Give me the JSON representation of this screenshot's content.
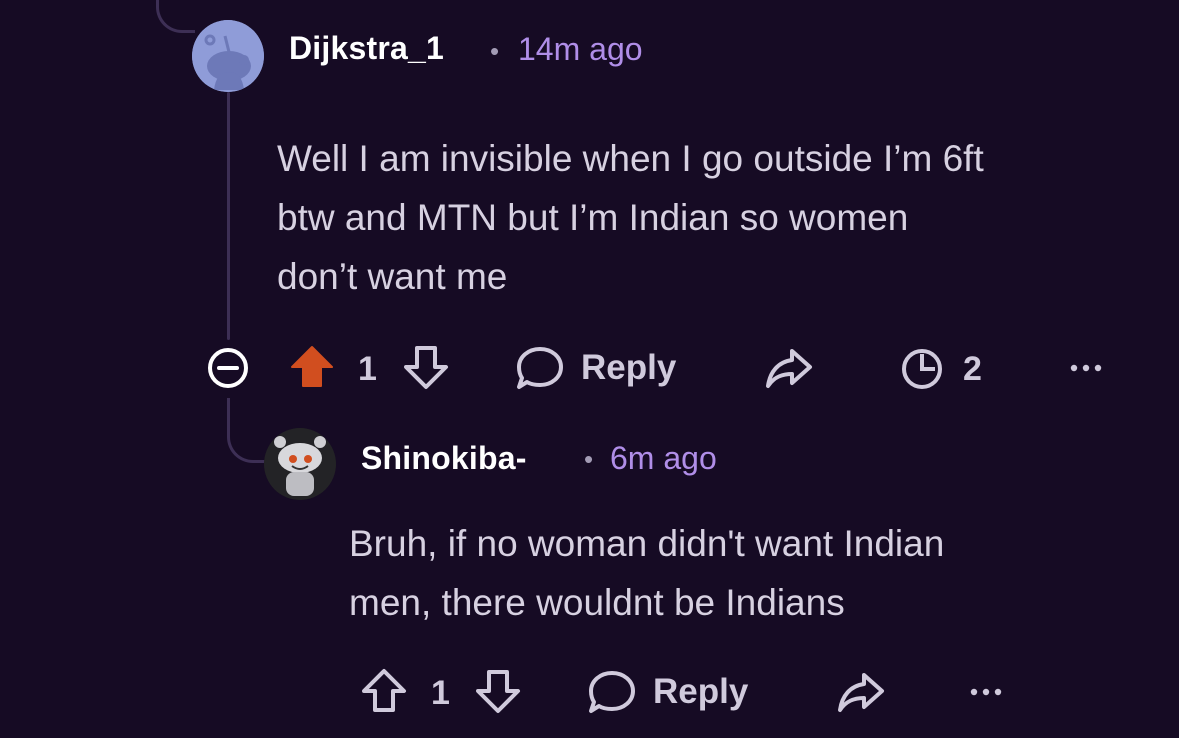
{
  "comments": [
    {
      "username": "Dijkstra_1",
      "separator": "•",
      "time": "14m ago",
      "body_lines": [
        "Well I am invisible when I go outside I’m 6ft",
        "btw and MTN but I’m Indian so women",
        "don’t want me"
      ],
      "votes": "1",
      "upvoted": true,
      "reply_label": "Reply",
      "award_count": "2"
    },
    {
      "username": "Shinokiba-",
      "separator": "•",
      "time": "6m ago",
      "body_lines": [
        "Bruh, if no woman didn't want Indian",
        "men, there wouldnt be Indians"
      ],
      "votes": "1",
      "upvoted": false,
      "reply_label": "Reply"
    }
  ],
  "colors": {
    "background": "#160b24",
    "upvote_active": "#d14e1f",
    "timestamp": "#b08ee8",
    "thread_line": "#3d2f55"
  },
  "icons": [
    "collapse-icon",
    "upvote-icon",
    "downvote-icon",
    "reply-bubble-icon",
    "share-icon",
    "award-icon",
    "more-icon"
  ]
}
